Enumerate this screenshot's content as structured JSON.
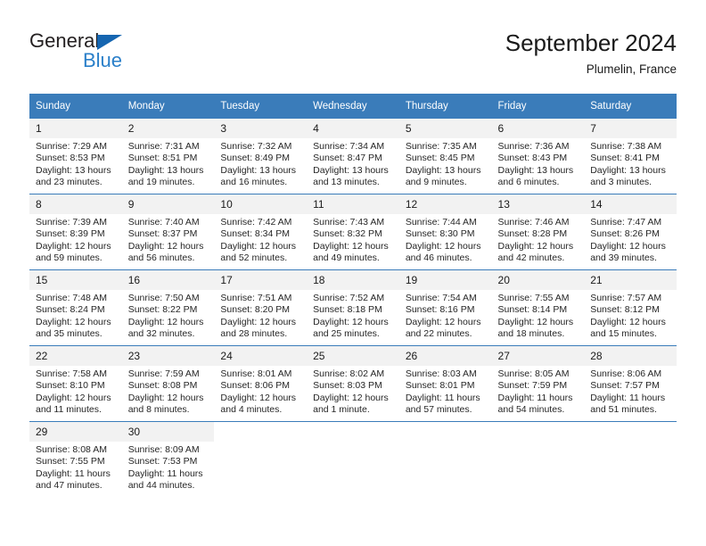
{
  "logo": {
    "word1": "General",
    "word2": "Blue",
    "triangle_color": "#1565b0",
    "word2_color": "#2a7fc9"
  },
  "header": {
    "title": "September 2024",
    "subtitle": "Plumelin, France"
  },
  "theme": {
    "header_bg": "#3a7cba",
    "header_text": "#ffffff",
    "daynum_bg": "#f2f2f2",
    "row_divider": "#3a7cba"
  },
  "weekday_headers": [
    "Sunday",
    "Monday",
    "Tuesday",
    "Wednesday",
    "Thursday",
    "Friday",
    "Saturday"
  ],
  "weeks": [
    [
      {
        "day": "1",
        "sunrise": "Sunrise: 7:29 AM",
        "sunset": "Sunset: 8:53 PM",
        "daylight": "Daylight: 13 hours and 23 minutes."
      },
      {
        "day": "2",
        "sunrise": "Sunrise: 7:31 AM",
        "sunset": "Sunset: 8:51 PM",
        "daylight": "Daylight: 13 hours and 19 minutes."
      },
      {
        "day": "3",
        "sunrise": "Sunrise: 7:32 AM",
        "sunset": "Sunset: 8:49 PM",
        "daylight": "Daylight: 13 hours and 16 minutes."
      },
      {
        "day": "4",
        "sunrise": "Sunrise: 7:34 AM",
        "sunset": "Sunset: 8:47 PM",
        "daylight": "Daylight: 13 hours and 13 minutes."
      },
      {
        "day": "5",
        "sunrise": "Sunrise: 7:35 AM",
        "sunset": "Sunset: 8:45 PM",
        "daylight": "Daylight: 13 hours and 9 minutes."
      },
      {
        "day": "6",
        "sunrise": "Sunrise: 7:36 AM",
        "sunset": "Sunset: 8:43 PM",
        "daylight": "Daylight: 13 hours and 6 minutes."
      },
      {
        "day": "7",
        "sunrise": "Sunrise: 7:38 AM",
        "sunset": "Sunset: 8:41 PM",
        "daylight": "Daylight: 13 hours and 3 minutes."
      }
    ],
    [
      {
        "day": "8",
        "sunrise": "Sunrise: 7:39 AM",
        "sunset": "Sunset: 8:39 PM",
        "daylight": "Daylight: 12 hours and 59 minutes."
      },
      {
        "day": "9",
        "sunrise": "Sunrise: 7:40 AM",
        "sunset": "Sunset: 8:37 PM",
        "daylight": "Daylight: 12 hours and 56 minutes."
      },
      {
        "day": "10",
        "sunrise": "Sunrise: 7:42 AM",
        "sunset": "Sunset: 8:34 PM",
        "daylight": "Daylight: 12 hours and 52 minutes."
      },
      {
        "day": "11",
        "sunrise": "Sunrise: 7:43 AM",
        "sunset": "Sunset: 8:32 PM",
        "daylight": "Daylight: 12 hours and 49 minutes."
      },
      {
        "day": "12",
        "sunrise": "Sunrise: 7:44 AM",
        "sunset": "Sunset: 8:30 PM",
        "daylight": "Daylight: 12 hours and 46 minutes."
      },
      {
        "day": "13",
        "sunrise": "Sunrise: 7:46 AM",
        "sunset": "Sunset: 8:28 PM",
        "daylight": "Daylight: 12 hours and 42 minutes."
      },
      {
        "day": "14",
        "sunrise": "Sunrise: 7:47 AM",
        "sunset": "Sunset: 8:26 PM",
        "daylight": "Daylight: 12 hours and 39 minutes."
      }
    ],
    [
      {
        "day": "15",
        "sunrise": "Sunrise: 7:48 AM",
        "sunset": "Sunset: 8:24 PM",
        "daylight": "Daylight: 12 hours and 35 minutes."
      },
      {
        "day": "16",
        "sunrise": "Sunrise: 7:50 AM",
        "sunset": "Sunset: 8:22 PM",
        "daylight": "Daylight: 12 hours and 32 minutes."
      },
      {
        "day": "17",
        "sunrise": "Sunrise: 7:51 AM",
        "sunset": "Sunset: 8:20 PM",
        "daylight": "Daylight: 12 hours and 28 minutes."
      },
      {
        "day": "18",
        "sunrise": "Sunrise: 7:52 AM",
        "sunset": "Sunset: 8:18 PM",
        "daylight": "Daylight: 12 hours and 25 minutes."
      },
      {
        "day": "19",
        "sunrise": "Sunrise: 7:54 AM",
        "sunset": "Sunset: 8:16 PM",
        "daylight": "Daylight: 12 hours and 22 minutes."
      },
      {
        "day": "20",
        "sunrise": "Sunrise: 7:55 AM",
        "sunset": "Sunset: 8:14 PM",
        "daylight": "Daylight: 12 hours and 18 minutes."
      },
      {
        "day": "21",
        "sunrise": "Sunrise: 7:57 AM",
        "sunset": "Sunset: 8:12 PM",
        "daylight": "Daylight: 12 hours and 15 minutes."
      }
    ],
    [
      {
        "day": "22",
        "sunrise": "Sunrise: 7:58 AM",
        "sunset": "Sunset: 8:10 PM",
        "daylight": "Daylight: 12 hours and 11 minutes."
      },
      {
        "day": "23",
        "sunrise": "Sunrise: 7:59 AM",
        "sunset": "Sunset: 8:08 PM",
        "daylight": "Daylight: 12 hours and 8 minutes."
      },
      {
        "day": "24",
        "sunrise": "Sunrise: 8:01 AM",
        "sunset": "Sunset: 8:06 PM",
        "daylight": "Daylight: 12 hours and 4 minutes."
      },
      {
        "day": "25",
        "sunrise": "Sunrise: 8:02 AM",
        "sunset": "Sunset: 8:03 PM",
        "daylight": "Daylight: 12 hours and 1 minute."
      },
      {
        "day": "26",
        "sunrise": "Sunrise: 8:03 AM",
        "sunset": "Sunset: 8:01 PM",
        "daylight": "Daylight: 11 hours and 57 minutes."
      },
      {
        "day": "27",
        "sunrise": "Sunrise: 8:05 AM",
        "sunset": "Sunset: 7:59 PM",
        "daylight": "Daylight: 11 hours and 54 minutes."
      },
      {
        "day": "28",
        "sunrise": "Sunrise: 8:06 AM",
        "sunset": "Sunset: 7:57 PM",
        "daylight": "Daylight: 11 hours and 51 minutes."
      }
    ],
    [
      {
        "day": "29",
        "sunrise": "Sunrise: 8:08 AM",
        "sunset": "Sunset: 7:55 PM",
        "daylight": "Daylight: 11 hours and 47 minutes."
      },
      {
        "day": "30",
        "sunrise": "Sunrise: 8:09 AM",
        "sunset": "Sunset: 7:53 PM",
        "daylight": "Daylight: 11 hours and 44 minutes."
      },
      {
        "day": "",
        "sunrise": "",
        "sunset": "",
        "daylight": ""
      },
      {
        "day": "",
        "sunrise": "",
        "sunset": "",
        "daylight": ""
      },
      {
        "day": "",
        "sunrise": "",
        "sunset": "",
        "daylight": ""
      },
      {
        "day": "",
        "sunrise": "",
        "sunset": "",
        "daylight": ""
      },
      {
        "day": "",
        "sunrise": "",
        "sunset": "",
        "daylight": ""
      }
    ]
  ]
}
